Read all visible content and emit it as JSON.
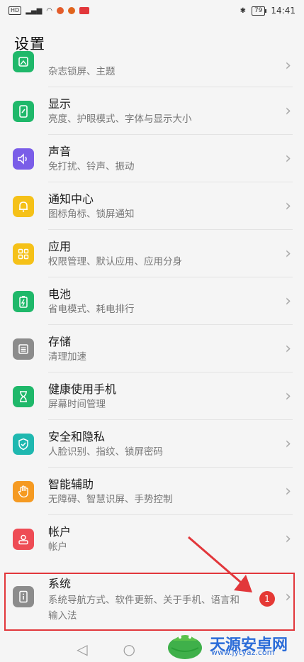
{
  "status": {
    "battery": "79",
    "time": "14:41"
  },
  "header": {
    "title": "设置"
  },
  "items": [
    {
      "title": "",
      "sub": "杂志锁屏、主题",
      "icon": "wallpaper-icon",
      "color": "#1fb86a"
    },
    {
      "title": "显示",
      "sub": "亮度、护眼模式、字体与显示大小",
      "icon": "display-icon",
      "color": "#1fb86a"
    },
    {
      "title": "声音",
      "sub": "免打扰、铃声、振动",
      "icon": "sound-icon",
      "color": "#7a5de8"
    },
    {
      "title": "通知中心",
      "sub": "图标角标、锁屏通知",
      "icon": "bell-icon",
      "color": "#f5c118"
    },
    {
      "title": "应用",
      "sub": "权限管理、默认应用、应用分身",
      "icon": "apps-icon",
      "color": "#f5c118"
    },
    {
      "title": "电池",
      "sub": "省电模式、耗电排行",
      "icon": "battery-icon",
      "color": "#1fb86a"
    },
    {
      "title": "存储",
      "sub": "清理加速",
      "icon": "storage-icon",
      "color": "#8c8c8c"
    },
    {
      "title": "健康使用手机",
      "sub": "屏幕时间管理",
      "icon": "hourglass-icon",
      "color": "#1fb86a"
    },
    {
      "title": "安全和隐私",
      "sub": "人脸识别、指纹、锁屏密码",
      "icon": "shield-icon",
      "color": "#1fb8b0"
    },
    {
      "title": "智能辅助",
      "sub": "无障碍、智慧识屏、手势控制",
      "icon": "hand-icon",
      "color": "#f59a22"
    },
    {
      "title": "帐户",
      "sub": "帐户",
      "icon": "account-icon",
      "color": "#ee4c55"
    }
  ],
  "system": {
    "title": "系统",
    "sub": "系统导航方式、软件更新、关于手机、语言和输入法",
    "badge": "1",
    "icon": "info-icon",
    "color": "#8c8c8c"
  },
  "watermark": {
    "name": "天源安卓网",
    "url": "www.jytyaz.com"
  },
  "highlight_color": "#e2373b"
}
